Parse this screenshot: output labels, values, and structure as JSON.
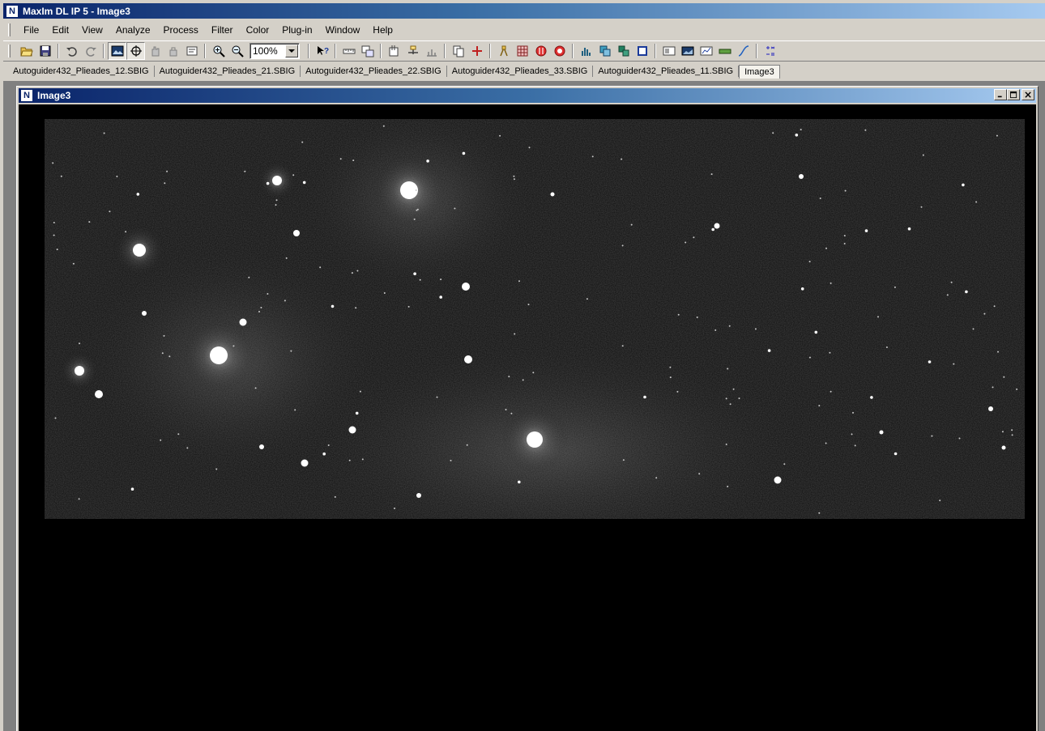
{
  "app": {
    "title": "MaxIm DL IP 5 - Image3",
    "icon": "maxim-logo-icon"
  },
  "menu": {
    "items": [
      {
        "label": "File",
        "name": "menu-file"
      },
      {
        "label": "Edit",
        "name": "menu-edit"
      },
      {
        "label": "View",
        "name": "menu-view"
      },
      {
        "label": "Analyze",
        "name": "menu-analyze"
      },
      {
        "label": "Process",
        "name": "menu-process"
      },
      {
        "label": "Filter",
        "name": "menu-filter"
      },
      {
        "label": "Color",
        "name": "menu-color"
      },
      {
        "label": "Plug-in",
        "name": "menu-plugin"
      },
      {
        "label": "Window",
        "name": "menu-window"
      },
      {
        "label": "Help",
        "name": "menu-help"
      }
    ]
  },
  "toolbar": {
    "zoom_value": "100%"
  },
  "tabs": {
    "items": [
      {
        "label": "Autoguider432_Plieades_12.SBIG",
        "active": false
      },
      {
        "label": "Autoguider432_Plieades_21.SBIG",
        "active": false
      },
      {
        "label": "Autoguider432_Plieades_22.SBIG",
        "active": false
      },
      {
        "label": "Autoguider432_Plieades_33.SBIG",
        "active": false
      },
      {
        "label": "Autoguider432_Plieades_11.SBIG",
        "active": false
      },
      {
        "label": "Image3",
        "active": true
      }
    ]
  },
  "child_window": {
    "title": "Image3"
  },
  "colors": {
    "title_start": "#0a246a",
    "title_end": "#a6caf0",
    "face": "#d4d0c8",
    "mdi_background": "#808080",
    "image_background": "#000000"
  }
}
